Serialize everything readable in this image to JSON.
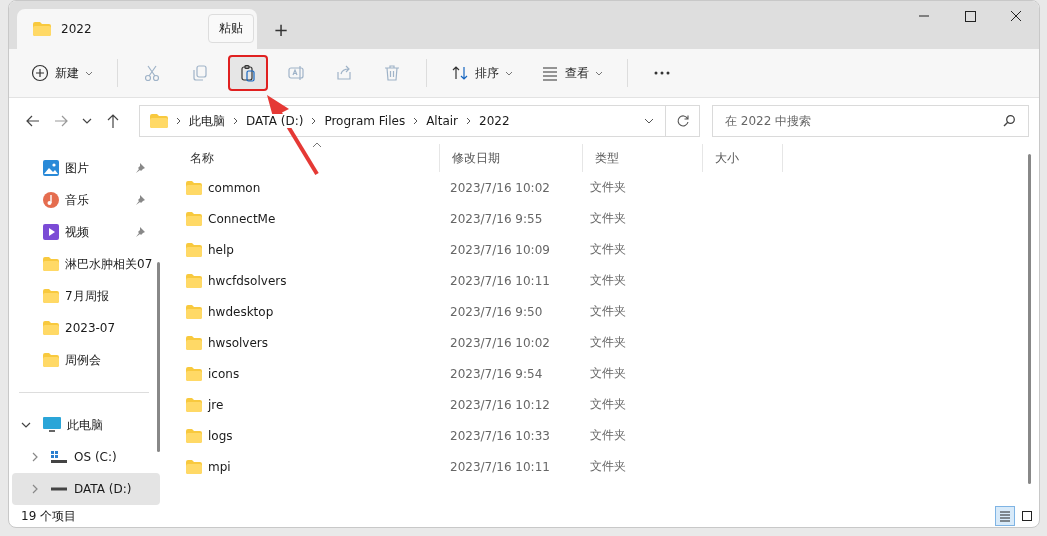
{
  "tab": {
    "title": "2022"
  },
  "new_tab": "+",
  "tooltip": "粘贴",
  "toolbar": [
    {
      "kind": "new",
      "label": "新建",
      "disabled": false,
      "highlighted": false
    },
    {
      "kind": "cut",
      "disabled": true,
      "highlighted": false
    },
    {
      "kind": "copy",
      "disabled": true,
      "highlighted": false
    },
    {
      "kind": "paste",
      "disabled": false,
      "highlighted": true
    },
    {
      "kind": "rename",
      "disabled": true,
      "highlighted": false
    },
    {
      "kind": "share",
      "disabled": true,
      "highlighted": false
    },
    {
      "kind": "delete",
      "disabled": true,
      "highlighted": false
    },
    {
      "kind": "sort",
      "label": "排序",
      "disabled": false,
      "highlighted": false
    },
    {
      "kind": "view",
      "label": "查看",
      "disabled": false,
      "highlighted": false
    },
    {
      "kind": "more",
      "disabled": false,
      "highlighted": false
    }
  ],
  "address": {
    "segments": [
      "此电脑",
      "DATA (D:)",
      "Program Files",
      "Altair",
      "2022"
    ]
  },
  "search": {
    "placeholder": "在 2022 中搜索"
  },
  "sidebar": {
    "quick_access": [
      {
        "label": "图片",
        "kind": "pictures",
        "pinned": true
      },
      {
        "label": "音乐",
        "kind": "music",
        "pinned": true
      },
      {
        "label": "视频",
        "kind": "videos",
        "pinned": true
      },
      {
        "label": "淋巴水肿相关07",
        "kind": "folder",
        "pinned": false
      },
      {
        "label": "7月周报",
        "kind": "folder",
        "pinned": false
      },
      {
        "label": "2023-07",
        "kind": "folder",
        "pinned": false
      },
      {
        "label": "周例会",
        "kind": "folder",
        "pinned": false
      }
    ],
    "this_pc": {
      "label": "此电脑",
      "expanded": true,
      "children": [
        {
          "label": "OS (C:)",
          "kind": "system",
          "selected": false
        },
        {
          "label": "DATA (D:)",
          "kind": "drive",
          "selected": true
        }
      ]
    }
  },
  "table": {
    "columns": [
      {
        "label": "名称",
        "sorted": true
      },
      {
        "label": "修改日期",
        "sorted": false
      },
      {
        "label": "类型",
        "sorted": false
      },
      {
        "label": "大小",
        "sorted": false
      }
    ],
    "rows": [
      {
        "name": "common",
        "modified": "2023/7/16 10:02",
        "type": "文件夹"
      },
      {
        "name": "ConnectMe",
        "modified": "2023/7/16 9:55",
        "type": "文件夹"
      },
      {
        "name": "help",
        "modified": "2023/7/16 10:09",
        "type": "文件夹"
      },
      {
        "name": "hwcfdsolvers",
        "modified": "2023/7/16 10:11",
        "type": "文件夹"
      },
      {
        "name": "hwdesktop",
        "modified": "2023/7/16 9:50",
        "type": "文件夹"
      },
      {
        "name": "hwsolvers",
        "modified": "2023/7/16 10:02",
        "type": "文件夹"
      },
      {
        "name": "icons",
        "modified": "2023/7/16 9:54",
        "type": "文件夹"
      },
      {
        "name": "jre",
        "modified": "2023/7/16 10:12",
        "type": "文件夹"
      },
      {
        "name": "logs",
        "modified": "2023/7/16 10:33",
        "type": "文件夹"
      },
      {
        "name": "mpi",
        "modified": "2023/7/16 10:11",
        "type": "文件夹"
      }
    ]
  },
  "status_bar": {
    "count": "19 个项目",
    "views": [
      {
        "kind": "details",
        "selected": true
      },
      {
        "kind": "tiles",
        "selected": false
      }
    ]
  }
}
